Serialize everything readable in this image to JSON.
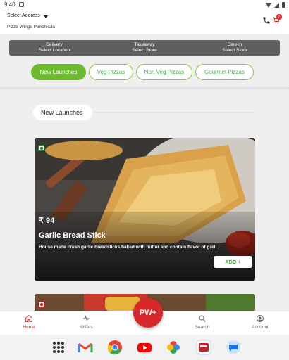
{
  "status_bar": {
    "time": "9:40"
  },
  "header": {
    "address_label": "Select Address",
    "address_value": "Pizza Wings Panchkula",
    "cart_count": "7"
  },
  "order_modes": [
    {
      "title": "Delivery",
      "subtitle": "Select Location"
    },
    {
      "title": "Takeaway",
      "subtitle": "Select Store"
    },
    {
      "title": "Dine-in",
      "subtitle": "Select Store"
    }
  ],
  "category_tabs": [
    {
      "label": "New Launches",
      "active": true
    },
    {
      "label": "Veg Pizzas",
      "active": false
    },
    {
      "label": "Non Veg Pizzas",
      "active": false
    },
    {
      "label": "Gourmet Pizzas",
      "active": false
    }
  ],
  "section": {
    "title": "New Launches"
  },
  "product": {
    "price": "₹ 94",
    "name": "Garlic Bread Stick",
    "description": "House made Fresh garlic breadsticks baked with butter and contain flavor of garl...",
    "add_label": "ADD +",
    "veg": true
  },
  "bottom_nav": {
    "items": [
      {
        "label": "Home",
        "icon": "home-icon",
        "active": true
      },
      {
        "label": "Offers",
        "icon": "pulse-icon",
        "active": false
      },
      {
        "label": "Search",
        "icon": "search-icon",
        "active": false
      },
      {
        "label": "Account",
        "icon": "account-icon",
        "active": false
      }
    ],
    "fab_label": "PW+"
  },
  "dock_apps": [
    "app-drawer-icon",
    "gmail-icon",
    "chrome-icon",
    "youtube-icon",
    "photos-icon",
    "pizza-wings-icon",
    "messages-icon"
  ],
  "colors": {
    "accent_green": "#6cbb2f",
    "brand_red": "#d7282b",
    "mode_bar": "#5f5f5f"
  }
}
